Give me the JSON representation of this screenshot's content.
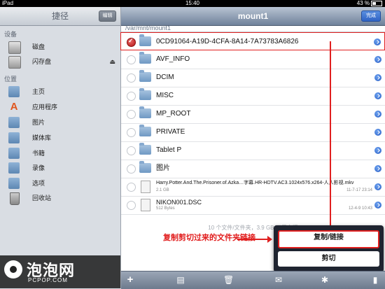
{
  "status": {
    "device": "iPad",
    "time": "15:40",
    "battery": "43 %"
  },
  "sidebar": {
    "title": "捷径",
    "edit_label": "编辑",
    "section_devices": "设备",
    "section_places": "位置",
    "devices": [
      {
        "label": "磁盘",
        "icon": "disk-icon"
      },
      {
        "label": "闪存盘",
        "icon": "flash-drive-icon"
      }
    ],
    "places": [
      {
        "label": "主页",
        "icon": "home-icon"
      },
      {
        "label": "应用程序",
        "icon": "applications-icon"
      },
      {
        "label": "图片",
        "icon": "pictures-folder-icon"
      },
      {
        "label": "媒体库",
        "icon": "media-library-icon"
      },
      {
        "label": "书籍",
        "icon": "books-folder-icon"
      },
      {
        "label": "录像",
        "icon": "videos-folder-icon"
      },
      {
        "label": "选项",
        "icon": "options-icon"
      },
      {
        "label": "回收站",
        "icon": "trash-icon"
      }
    ]
  },
  "watermark": {
    "text": "泡泡网",
    "sub": "PCPOP.COM"
  },
  "main": {
    "title": "mount1",
    "done_label": "完成",
    "path": "/var/mnt/mount1",
    "rows": [
      {
        "name": "0CD91064-A19D-4CFA-8A14-7A73783A6826"
      },
      {
        "name": "AVF_INFO"
      },
      {
        "name": "DCIM"
      },
      {
        "name": "MISC"
      },
      {
        "name": "MP_ROOT"
      },
      {
        "name": "PRIVATE"
      },
      {
        "name": "Tablet P"
      },
      {
        "name": "图片"
      }
    ],
    "files": [
      {
        "name": "Harry.Potter.And.The.Prisoner.of.Azka…字幕.HR-HDTV.AC3.1024x576.x264-人人影视.mkv",
        "size": "2.1 GB",
        "date": "11-7-17 23:14"
      },
      {
        "name": "NIKON001.DSC",
        "size": "512 Bytes",
        "date": "12-4-9 10:43"
      }
    ],
    "summary": "10 个文件/文件夹，3.9 GB 可用空间"
  },
  "annotation": {
    "text": "复制剪切过来的文件夹链接",
    "color": "#e02020"
  },
  "popup": {
    "copy_label": "复制/链接",
    "cut_label": "剪切"
  },
  "toolbar": {
    "add_label": "+"
  }
}
